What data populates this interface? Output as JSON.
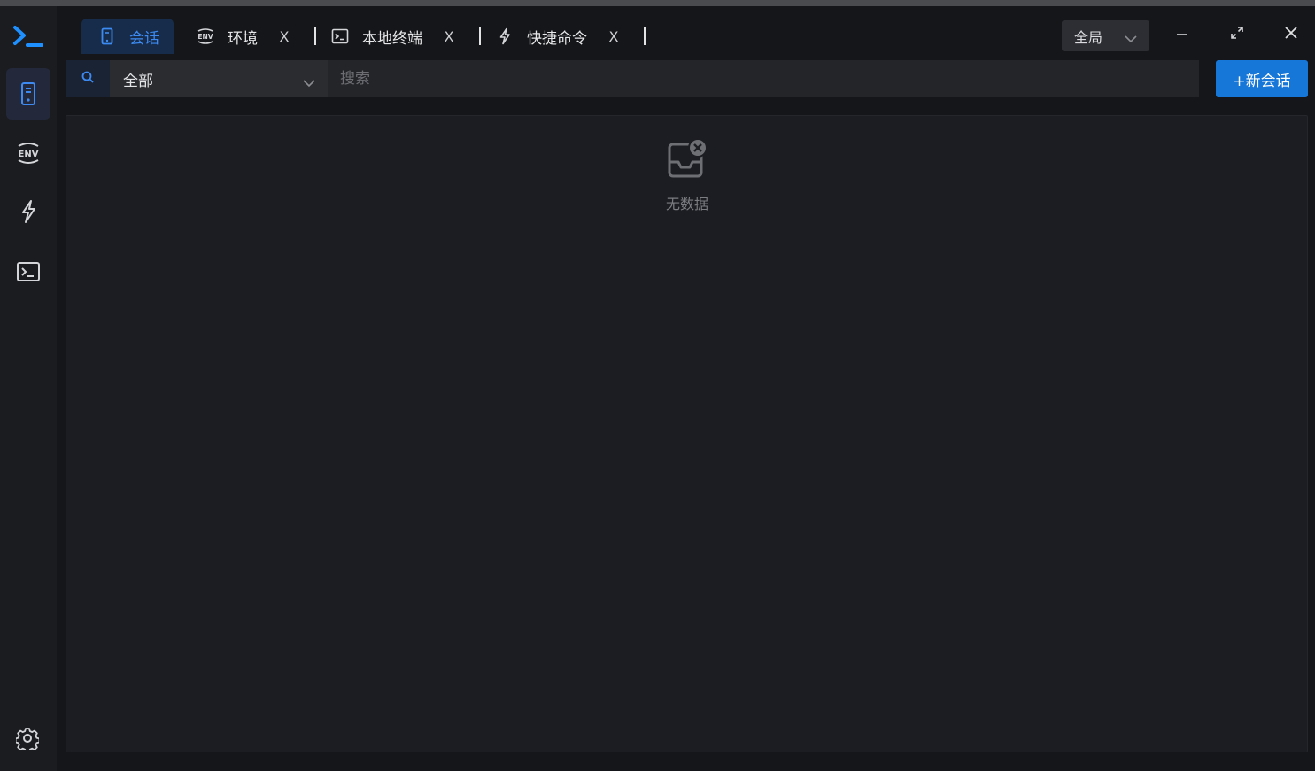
{
  "app": {
    "logo": "terminal-prompt-logo"
  },
  "rail": {
    "items": [
      {
        "name": "sessions",
        "icon": "phone-icon",
        "active": true
      },
      {
        "name": "env",
        "icon": "env-icon",
        "active": false
      },
      {
        "name": "quick-commands",
        "icon": "lightning-icon",
        "active": false
      },
      {
        "name": "local-terminal",
        "icon": "terminal-icon",
        "active": false
      }
    ],
    "settings_icon": "gear-icon"
  },
  "tabs": [
    {
      "label": "会话",
      "icon": "phone-icon",
      "active": true,
      "closable": false
    },
    {
      "label": "环境",
      "icon": "env-icon",
      "active": false,
      "closable": true,
      "close": "X"
    },
    {
      "label": "本地终端",
      "icon": "terminal-icon",
      "active": false,
      "closable": true,
      "close": "X"
    },
    {
      "label": "快捷命令",
      "icon": "lightning-icon",
      "active": false,
      "closable": true,
      "close": "X"
    }
  ],
  "scope_select": {
    "value": "全局"
  },
  "window_controls": [
    "minimize-icon",
    "restore-icon",
    "close-icon"
  ],
  "toolbar": {
    "filter_value": "全部",
    "search_placeholder": "搜索",
    "new_session_label": "+新会话"
  },
  "main": {
    "empty_text": "无数据"
  },
  "colors": {
    "accent": "#1677d9",
    "active_tab_text": "#3d8bf2",
    "active_tab_bg": "#172c4a",
    "background": "#151619",
    "panel": "#1c1d22"
  }
}
